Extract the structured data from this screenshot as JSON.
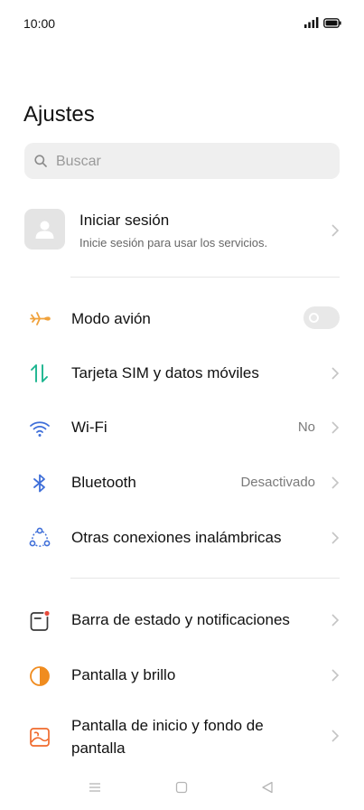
{
  "status": {
    "time": "10:00"
  },
  "page": {
    "title": "Ajustes"
  },
  "search": {
    "placeholder": "Buscar"
  },
  "account": {
    "title": "Iniciar sesión",
    "subtitle": "Inicie sesión para usar los servicios."
  },
  "settings": [
    {
      "label": "Modo avión",
      "icon": "airplane-icon",
      "control": "toggle",
      "toggle_on": false
    },
    {
      "label": "Tarjeta SIM y datos móviles",
      "icon": "sim-data-icon"
    },
    {
      "label": "Wi-Fi",
      "icon": "wifi-icon",
      "value": "No"
    },
    {
      "label": "Bluetooth",
      "icon": "bluetooth-icon",
      "value": "Desactivado"
    },
    {
      "label": "Otras conexiones inalámbricas",
      "icon": "connections-icon"
    },
    {
      "label": "Barra de estado y notificaciones",
      "icon": "notifications-icon"
    },
    {
      "label": "Pantalla y brillo",
      "icon": "display-brightness-icon"
    },
    {
      "label": "Pantalla de inicio y fondo de pantalla",
      "label_lines": [
        "Pantalla de inicio y fondo de",
        "pantalla"
      ],
      "icon": "wallpaper-icon"
    }
  ],
  "navbar": {
    "icons": [
      "menu-icon",
      "home-icon",
      "back-icon"
    ]
  },
  "colors": {
    "airplane": "#f0a23c",
    "sim": "#1bb58f",
    "wifi": "#3f6fd9",
    "bluetooth": "#3f6fd9",
    "connections": "#3f6fd9",
    "notifications": "#3a3a3a",
    "notification_dot": "#e64b3c",
    "display": "#f08c1f",
    "wallpaper": "#f06a2d",
    "chevron": "#c4c4c4"
  }
}
